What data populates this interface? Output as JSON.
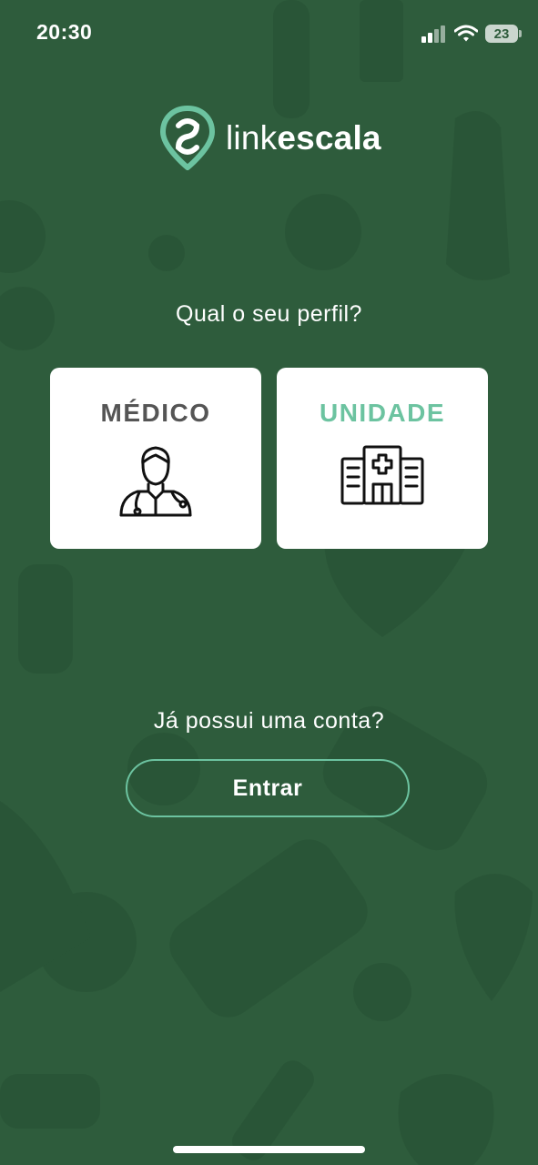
{
  "status_bar": {
    "time": "20:30",
    "battery_level": "23"
  },
  "logo": {
    "text_light": "link",
    "text_bold": "escala"
  },
  "profile_question": "Qual o seu perfil?",
  "profiles": [
    {
      "label": "MÉDICO",
      "icon": "doctor-icon"
    },
    {
      "label": "UNIDADE",
      "icon": "hospital-icon"
    }
  ],
  "account_question": "Já possui uma conta?",
  "login_button": "Entrar",
  "colors": {
    "background": "#2e5c3c",
    "accent": "#6cc3a0",
    "card": "#ffffff",
    "medico_label": "#555555"
  }
}
